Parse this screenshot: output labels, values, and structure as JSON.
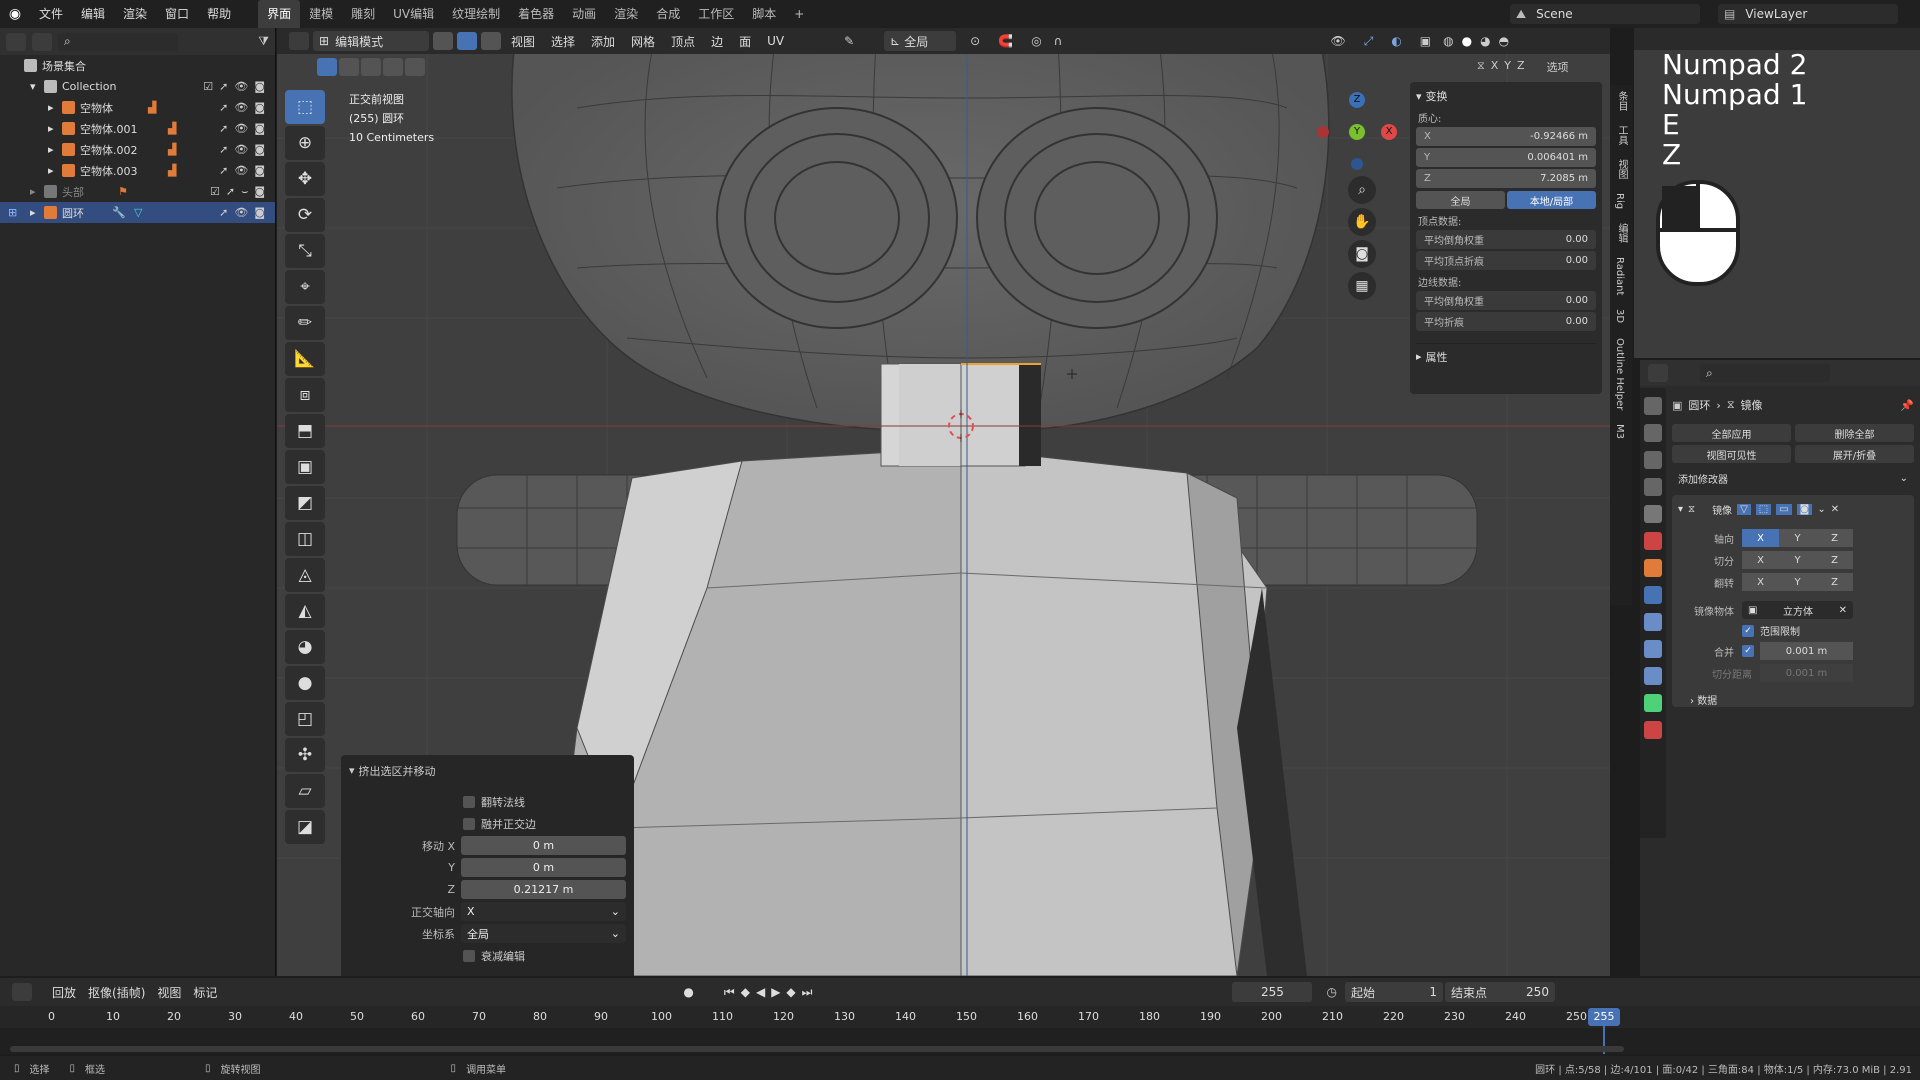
{
  "menu": [
    "文件",
    "编辑",
    "渲染",
    "窗口",
    "帮助"
  ],
  "workspaces": [
    "界面",
    "建模",
    "雕刻",
    "UV编辑",
    "纹理绘制",
    "着色器",
    "动画",
    "渲染",
    "合成",
    "工作区",
    "脚本",
    "+"
  ],
  "scene_label": "Scene",
  "viewlayer_label": "ViewLayer",
  "outliner": {
    "root": "场景集合",
    "rows": [
      {
        "label": "Collection",
        "indent": 1,
        "color": "#bbbbbb"
      },
      {
        "label": "空物体",
        "indent": 2,
        "color": "#e07b39"
      },
      {
        "label": "空物体.001",
        "indent": 2,
        "color": "#e07b39"
      },
      {
        "label": "空物体.002",
        "indent": 2,
        "color": "#e07b39"
      },
      {
        "label": "空物体.003",
        "indent": 2,
        "color": "#e07b39"
      },
      {
        "label": "头部",
        "indent": 1,
        "color": "#777777"
      },
      {
        "label": "圆环",
        "indent": 1,
        "color": "#e07b39",
        "selected": true
      }
    ]
  },
  "viewport": {
    "mode": "编辑模式",
    "menus": [
      "视图",
      "选择",
      "添加",
      "网格",
      "顶点",
      "边",
      "面",
      "UV"
    ],
    "transform_orient": "全局",
    "options": "选项",
    "info": [
      "正交前视图",
      "(255) 圆环",
      "10 Centimeters"
    ],
    "axes": [
      "X",
      "Y",
      "Z"
    ]
  },
  "npanel": {
    "title": "变换",
    "median_label": "质心:",
    "x": "-0.92466 m",
    "y": "0.006401 m",
    "z": "7.2085 m",
    "global": "全局",
    "local": "本地/局部",
    "vertex_data": "顶点数据:",
    "vertex_bevel": "平均倒角权重",
    "vertex_bevel_val": "0.00",
    "vertex_crease": "平均顶点折痕",
    "vertex_crease_val": "0.00",
    "edge_data": "边线数据:",
    "edge_bevel": "平均倒角权重",
    "edge_bevel_val": "0.00",
    "edge_crease": "平均折痕",
    "edge_crease_val": "0.00",
    "properties": "属性"
  },
  "operator": {
    "title": "挤出选区并移动",
    "flip_normals": "翻转法线",
    "dissolve": "融并正交边",
    "move_x_label": "移动 X",
    "move_x": "0 m",
    "move_y_label": "Y",
    "move_y": "0 m",
    "move_z_label": "Z",
    "move_z": "0.21217 m",
    "ortho_label": "正交轴向",
    "ortho": "X",
    "coord_label": "坐标系",
    "coord": "全局",
    "proportional": "衰减编辑"
  },
  "sidetabs": [
    "条目",
    "工具",
    "视图",
    "Rig",
    "编辑",
    "Radiant",
    "3D",
    "Outline Helper",
    "M3"
  ],
  "keys": [
    "Numpad 2",
    "Numpad 1",
    "E",
    "Z"
  ],
  "props": {
    "breadcrumb_obj": "圆环",
    "breadcrumb_mod": "镜像",
    "apply_all": "全部应用",
    "delete_all": "删除全部",
    "viewport_vis": "视图可见性",
    "expand": "展开/折叠",
    "add_modifier": "添加修改器",
    "modifier_name": "镜像",
    "axis_label": "轴向",
    "bisect_label": "切分",
    "flip_label": "翻转",
    "mirror_obj_label": "镜像物体",
    "mirror_obj": "立方体",
    "clipping": "范围限制",
    "merge_label": "合并",
    "merge_val": "0.001 m",
    "bisect_dist_label": "切分距离",
    "bisect_dist": "0.001 m",
    "data": "数据"
  },
  "timeline": {
    "menus": [
      "回放",
      "抠像(插帧)",
      "视图",
      "标记"
    ],
    "current": "255",
    "start_label": "起始",
    "start": "1",
    "end_label": "结束点",
    "end": "250",
    "ticks": [
      "0",
      "10",
      "20",
      "30",
      "40",
      "50",
      "60",
      "70",
      "80",
      "90",
      "100",
      "110",
      "120",
      "130",
      "140",
      "150",
      "160",
      "170",
      "180",
      "190",
      "200",
      "210",
      "220",
      "230",
      "240",
      "250"
    ],
    "playhead": "255"
  },
  "status": {
    "select": "选择",
    "box": "框选",
    "rotate": "旋转视图",
    "menu": "调用菜单",
    "stats": "圆环 | 点:5/58 | 边:4/101 | 面:0/42 | 三角面:84 | 物体:1/5 | 内存:73.0 MiB | 2.91"
  },
  "colors": {
    "accent": "#4772b3",
    "select": "#334d80",
    "active_edge": "#f0a030"
  }
}
